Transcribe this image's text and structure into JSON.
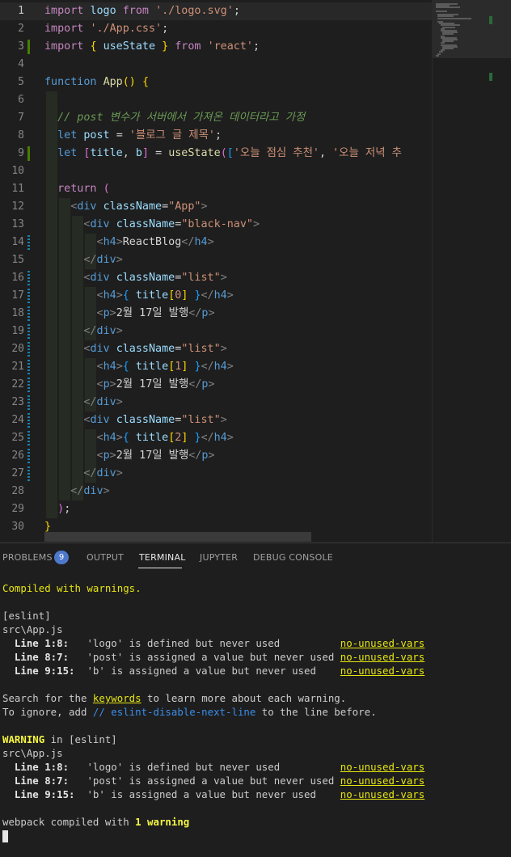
{
  "editor": {
    "lines": [
      {
        "n": "1",
        "segs": [
          [
            "tk-kw",
            "import"
          ],
          [
            "tk-txt",
            " "
          ],
          [
            "tk-var",
            "logo"
          ],
          [
            "tk-txt",
            " "
          ],
          [
            "tk-kw",
            "from"
          ],
          [
            "tk-txt",
            " "
          ],
          [
            "tk-str",
            "'./logo.svg'"
          ],
          [
            "tk-op",
            ";"
          ]
        ]
      },
      {
        "n": "2",
        "segs": [
          [
            "tk-kw",
            "import"
          ],
          [
            "tk-txt",
            " "
          ],
          [
            "tk-str",
            "'./App.css'"
          ],
          [
            "tk-op",
            ";"
          ]
        ]
      },
      {
        "n": "3",
        "segs": [
          [
            "tk-kw",
            "import"
          ],
          [
            "tk-txt",
            " "
          ],
          [
            "tk-br",
            "{"
          ],
          [
            "tk-txt",
            " "
          ],
          [
            "tk-var",
            "useState"
          ],
          [
            "tk-txt",
            " "
          ],
          [
            "tk-br",
            "}"
          ],
          [
            "tk-txt",
            " "
          ],
          [
            "tk-kw",
            "from"
          ],
          [
            "tk-txt",
            " "
          ],
          [
            "tk-str",
            "'react'"
          ],
          [
            "tk-op",
            ";"
          ]
        ]
      },
      {
        "n": "4",
        "segs": []
      },
      {
        "n": "5",
        "segs": [
          [
            "tk-kwb",
            "function"
          ],
          [
            "tk-txt",
            " "
          ],
          [
            "tk-fn",
            "App"
          ],
          [
            "tk-br",
            "()"
          ],
          [
            "tk-txt",
            " "
          ],
          [
            "tk-br",
            "{"
          ]
        ]
      },
      {
        "n": "6",
        "segs": []
      },
      {
        "n": "7",
        "segs": [
          [
            "tk-txt",
            "  "
          ],
          [
            "tk-cm",
            "// post 변수가 서버에서 가져온 데이터라고 가정"
          ]
        ]
      },
      {
        "n": "8",
        "segs": [
          [
            "tk-txt",
            "  "
          ],
          [
            "tk-kwb",
            "let"
          ],
          [
            "tk-txt",
            " "
          ],
          [
            "tk-var",
            "post"
          ],
          [
            "tk-txt",
            " "
          ],
          [
            "tk-op",
            "="
          ],
          [
            "tk-txt",
            " "
          ],
          [
            "tk-str",
            "'블로그 글 제목'"
          ],
          [
            "tk-op",
            ";"
          ]
        ]
      },
      {
        "n": "9",
        "segs": [
          [
            "tk-txt",
            "  "
          ],
          [
            "tk-kwb",
            "let"
          ],
          [
            "tk-txt",
            " "
          ],
          [
            "tk-br2",
            "["
          ],
          [
            "tk-var",
            "title"
          ],
          [
            "tk-op",
            ","
          ],
          [
            "tk-txt",
            " "
          ],
          [
            "tk-var",
            "b"
          ],
          [
            "tk-br2",
            "]"
          ],
          [
            "tk-txt",
            " "
          ],
          [
            "tk-op",
            "="
          ],
          [
            "tk-txt",
            " "
          ],
          [
            "tk-fn",
            "useState"
          ],
          [
            "tk-br2",
            "("
          ],
          [
            "tk-br3",
            "["
          ],
          [
            "tk-str",
            "'오늘 점심 추천'"
          ],
          [
            "tk-op",
            ","
          ],
          [
            "tk-txt",
            " "
          ],
          [
            "tk-str",
            "'오늘 저녁 추"
          ]
        ]
      },
      {
        "n": "10",
        "segs": []
      },
      {
        "n": "11",
        "segs": [
          [
            "tk-txt",
            "  "
          ],
          [
            "tk-kw",
            "return"
          ],
          [
            "tk-txt",
            " "
          ],
          [
            "tk-br2",
            "("
          ]
        ]
      },
      {
        "n": "12",
        "segs": [
          [
            "tk-txt",
            "    "
          ],
          [
            "tk-punc",
            "<"
          ],
          [
            "tk-tag",
            "div"
          ],
          [
            "tk-txt",
            " "
          ],
          [
            "tk-attr",
            "className"
          ],
          [
            "tk-op",
            "="
          ],
          [
            "tk-str",
            "\"App\""
          ],
          [
            "tk-punc",
            ">"
          ]
        ]
      },
      {
        "n": "13",
        "segs": [
          [
            "tk-txt",
            "      "
          ],
          [
            "tk-punc",
            "<"
          ],
          [
            "tk-tag",
            "div"
          ],
          [
            "tk-txt",
            " "
          ],
          [
            "tk-attr",
            "className"
          ],
          [
            "tk-op",
            "="
          ],
          [
            "tk-str",
            "\"black-nav\""
          ],
          [
            "tk-punc",
            ">"
          ]
        ]
      },
      {
        "n": "14",
        "segs": [
          [
            "tk-txt",
            "        "
          ],
          [
            "tk-punc",
            "<"
          ],
          [
            "tk-tag",
            "h4"
          ],
          [
            "tk-punc",
            ">"
          ],
          [
            "tk-txt",
            "ReactBlog"
          ],
          [
            "tk-punc",
            "</"
          ],
          [
            "tk-tag",
            "h4"
          ],
          [
            "tk-punc",
            ">"
          ]
        ]
      },
      {
        "n": "15",
        "segs": [
          [
            "tk-txt",
            "      "
          ],
          [
            "tk-punc",
            "</"
          ],
          [
            "tk-tag",
            "div"
          ],
          [
            "tk-punc",
            ">"
          ]
        ]
      },
      {
        "n": "16",
        "segs": [
          [
            "tk-txt",
            "      "
          ],
          [
            "tk-punc",
            "<"
          ],
          [
            "tk-tag",
            "div"
          ],
          [
            "tk-txt",
            " "
          ],
          [
            "tk-attr",
            "className"
          ],
          [
            "tk-op",
            "="
          ],
          [
            "tk-str",
            "\"list\""
          ],
          [
            "tk-punc",
            ">"
          ]
        ]
      },
      {
        "n": "17",
        "segs": [
          [
            "tk-txt",
            "        "
          ],
          [
            "tk-punc",
            "<"
          ],
          [
            "tk-tag",
            "h4"
          ],
          [
            "tk-punc",
            ">"
          ],
          [
            "tk-br3",
            "{"
          ],
          [
            "tk-txt",
            " "
          ],
          [
            "tk-var",
            "title"
          ],
          [
            "tk-br",
            "["
          ],
          [
            "tk-str",
            "0"
          ],
          [
            "tk-br",
            "]"
          ],
          [
            "tk-txt",
            " "
          ],
          [
            "tk-br3",
            "}"
          ],
          [
            "tk-punc",
            "</"
          ],
          [
            "tk-tag",
            "h4"
          ],
          [
            "tk-punc",
            ">"
          ]
        ]
      },
      {
        "n": "18",
        "segs": [
          [
            "tk-txt",
            "        "
          ],
          [
            "tk-punc",
            "<"
          ],
          [
            "tk-tag",
            "p"
          ],
          [
            "tk-punc",
            ">"
          ],
          [
            "tk-txt",
            "2월 17일 발행"
          ],
          [
            "tk-punc",
            "</"
          ],
          [
            "tk-tag",
            "p"
          ],
          [
            "tk-punc",
            ">"
          ]
        ]
      },
      {
        "n": "19",
        "segs": [
          [
            "tk-txt",
            "      "
          ],
          [
            "tk-punc",
            "</"
          ],
          [
            "tk-tag",
            "div"
          ],
          [
            "tk-punc",
            ">"
          ]
        ]
      },
      {
        "n": "20",
        "segs": [
          [
            "tk-txt",
            "      "
          ],
          [
            "tk-punc",
            "<"
          ],
          [
            "tk-tag",
            "div"
          ],
          [
            "tk-txt",
            " "
          ],
          [
            "tk-attr",
            "className"
          ],
          [
            "tk-op",
            "="
          ],
          [
            "tk-str",
            "\"list\""
          ],
          [
            "tk-punc",
            ">"
          ]
        ]
      },
      {
        "n": "21",
        "segs": [
          [
            "tk-txt",
            "        "
          ],
          [
            "tk-punc",
            "<"
          ],
          [
            "tk-tag",
            "h4"
          ],
          [
            "tk-punc",
            ">"
          ],
          [
            "tk-br3",
            "{"
          ],
          [
            "tk-txt",
            " "
          ],
          [
            "tk-var",
            "title"
          ],
          [
            "tk-br",
            "["
          ],
          [
            "tk-str",
            "1"
          ],
          [
            "tk-br",
            "]"
          ],
          [
            "tk-txt",
            " "
          ],
          [
            "tk-br3",
            "}"
          ],
          [
            "tk-punc",
            "</"
          ],
          [
            "tk-tag",
            "h4"
          ],
          [
            "tk-punc",
            ">"
          ]
        ]
      },
      {
        "n": "22",
        "segs": [
          [
            "tk-txt",
            "        "
          ],
          [
            "tk-punc",
            "<"
          ],
          [
            "tk-tag",
            "p"
          ],
          [
            "tk-punc",
            ">"
          ],
          [
            "tk-txt",
            "2월 17일 발행"
          ],
          [
            "tk-punc",
            "</"
          ],
          [
            "tk-tag",
            "p"
          ],
          [
            "tk-punc",
            ">"
          ]
        ]
      },
      {
        "n": "23",
        "segs": [
          [
            "tk-txt",
            "      "
          ],
          [
            "tk-punc",
            "</"
          ],
          [
            "tk-tag",
            "div"
          ],
          [
            "tk-punc",
            ">"
          ]
        ]
      },
      {
        "n": "24",
        "segs": [
          [
            "tk-txt",
            "      "
          ],
          [
            "tk-punc",
            "<"
          ],
          [
            "tk-tag",
            "div"
          ],
          [
            "tk-txt",
            " "
          ],
          [
            "tk-attr",
            "className"
          ],
          [
            "tk-op",
            "="
          ],
          [
            "tk-str",
            "\"list\""
          ],
          [
            "tk-punc",
            ">"
          ]
        ]
      },
      {
        "n": "25",
        "segs": [
          [
            "tk-txt",
            "        "
          ],
          [
            "tk-punc",
            "<"
          ],
          [
            "tk-tag",
            "h4"
          ],
          [
            "tk-punc",
            ">"
          ],
          [
            "tk-br3",
            "{"
          ],
          [
            "tk-txt",
            " "
          ],
          [
            "tk-var",
            "title"
          ],
          [
            "tk-br",
            "["
          ],
          [
            "tk-str",
            "2"
          ],
          [
            "tk-br",
            "]"
          ],
          [
            "tk-txt",
            " "
          ],
          [
            "tk-br3",
            "}"
          ],
          [
            "tk-punc",
            "</"
          ],
          [
            "tk-tag",
            "h4"
          ],
          [
            "tk-punc",
            ">"
          ]
        ]
      },
      {
        "n": "26",
        "segs": [
          [
            "tk-txt",
            "        "
          ],
          [
            "tk-punc",
            "<"
          ],
          [
            "tk-tag",
            "p"
          ],
          [
            "tk-punc",
            ">"
          ],
          [
            "tk-txt",
            "2월 17일 발행"
          ],
          [
            "tk-punc",
            "</"
          ],
          [
            "tk-tag",
            "p"
          ],
          [
            "tk-punc",
            ">"
          ]
        ]
      },
      {
        "n": "27",
        "segs": [
          [
            "tk-txt",
            "      "
          ],
          [
            "tk-punc",
            "</"
          ],
          [
            "tk-tag",
            "div"
          ],
          [
            "tk-punc",
            ">"
          ]
        ]
      },
      {
        "n": "28",
        "segs": [
          [
            "tk-txt",
            "    "
          ],
          [
            "tk-punc",
            "</"
          ],
          [
            "tk-tag",
            "div"
          ],
          [
            "tk-punc",
            ">"
          ]
        ]
      },
      {
        "n": "29",
        "segs": [
          [
            "tk-txt",
            "  "
          ],
          [
            "tk-br2",
            ")"
          ],
          [
            "tk-op",
            ";"
          ]
        ]
      },
      {
        "n": "30",
        "segs": [
          [
            "tk-br",
            "}"
          ]
        ]
      }
    ],
    "active_line": "1",
    "modified_lines": [
      "3",
      "9"
    ],
    "changed_lines": [
      "14",
      "16",
      "17",
      "18",
      "19",
      "20",
      "21",
      "22",
      "23",
      "24",
      "25",
      "26",
      "27"
    ]
  },
  "panel": {
    "tabs": {
      "problems": "PROBLEMS",
      "problems_count": "9",
      "output": "OUTPUT",
      "terminal": "TERMINAL",
      "jupyter": "JUPYTER",
      "debug_console": "DEBUG CONSOLE"
    },
    "active_tab": "TERMINAL",
    "terminal": {
      "compiled": "Compiled with warnings.",
      "eslint_tag": "[eslint]",
      "file": "src\\App.js",
      "warnings": [
        {
          "loc": "  Line 1:8:  ",
          "msg": " 'logo' is defined but never used          ",
          "rule": "no-unused-vars"
        },
        {
          "loc": "  Line 8:7:  ",
          "msg": " 'post' is assigned a value but never used ",
          "rule": "no-unused-vars"
        },
        {
          "loc": "  Line 9:15: ",
          "msg": " 'b' is assigned a value but never used    ",
          "rule": "no-unused-vars"
        }
      ],
      "search_pre": "Search for the ",
      "search_kw": "keywords",
      "search_post": " to learn more about each warning.",
      "ignore_pre": "To ignore, add ",
      "ignore_kw": "// eslint-disable-next-line",
      "ignore_post": " to the line before.",
      "warning_label": "WARNING",
      "warning_in": " in [eslint]",
      "webpack_pre": "webpack compiled with ",
      "webpack_bold": "1 warning"
    }
  }
}
